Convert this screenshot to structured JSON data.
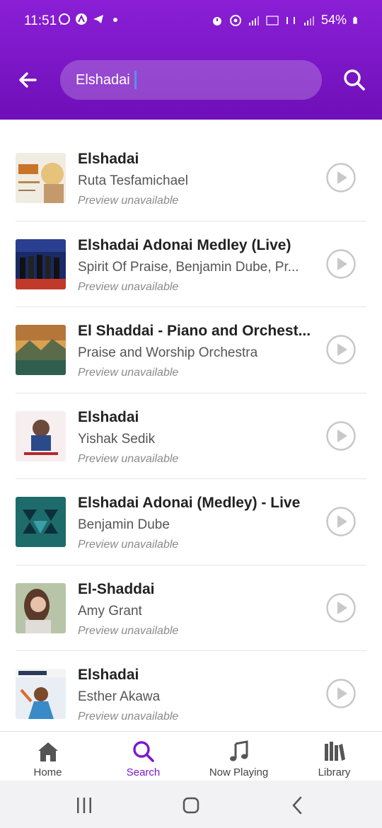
{
  "status_bar": {
    "time": "11:51",
    "battery": "54%"
  },
  "search": {
    "query": "Elshadai"
  },
  "colors": {
    "header": "#7a15c8",
    "accent": "#7b18cf",
    "play_icon": "#c8c8c8"
  },
  "results": [
    {
      "title": "Elshadai",
      "artist": "Ruta Tesfamichael",
      "note": "Preview unavailable"
    },
    {
      "title": "Elshadai Adonai Medley (Live)",
      "artist": "Spirit Of Praise, Benjamin Dube, Pr...",
      "note": "Preview unavailable"
    },
    {
      "title": "El Shaddai - Piano and Orchest...",
      "artist": "Praise and Worship Orchestra",
      "note": "Preview unavailable"
    },
    {
      "title": "Elshadai",
      "artist": "Yishak Sedik",
      "note": "Preview unavailable"
    },
    {
      "title": "Elshadai Adonai (Medley) - Live",
      "artist": "Benjamin Dube",
      "note": "Preview unavailable"
    },
    {
      "title": "El-Shaddai",
      "artist": "Amy Grant",
      "note": "Preview unavailable"
    },
    {
      "title": "Elshadai",
      "artist": "Esther Akawa",
      "note": "Preview unavailable"
    }
  ],
  "bottom_nav": {
    "home": "Home",
    "search": "Search",
    "now_playing": "Now Playing",
    "library": "Library",
    "active": "search"
  }
}
